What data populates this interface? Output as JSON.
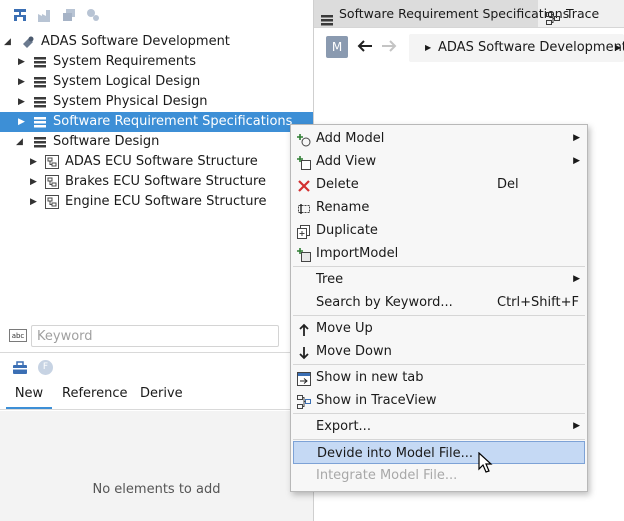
{
  "colors": {
    "selection": "#3d8fd6",
    "menu_highlight": "#c5d9f4",
    "delete_red": "#d32f2f"
  },
  "toolbar_icons": [
    "hierarchy-icon",
    "factory-icon",
    "stack-icon",
    "gear-group-icon"
  ],
  "tree": {
    "root": {
      "label": "ADAS Software Development",
      "icon": "project-icon"
    },
    "items": [
      {
        "label": "System Requirements",
        "icon": "list-icon"
      },
      {
        "label": "System Logical Design",
        "icon": "list-icon"
      },
      {
        "label": "System Physical Design",
        "icon": "list-icon"
      },
      {
        "label": "Software Requirement Specifications",
        "icon": "list-icon",
        "selected": true
      },
      {
        "label": "Software Design",
        "icon": "list-icon",
        "expanded": true
      },
      {
        "label": "ADAS ECU Software Structure",
        "icon": "structure-icon"
      },
      {
        "label": "Brakes ECU Software Structure",
        "icon": "structure-icon"
      },
      {
        "label": "Engine ECU Software Structure",
        "icon": "structure-icon"
      }
    ]
  },
  "keyword": {
    "placeholder": "Keyword",
    "badge": "abc"
  },
  "lower_panel": {
    "tabs": [
      "New",
      "Reference",
      "Derive"
    ],
    "active_tab": "New",
    "empty_text": "No elements to add",
    "filter_badge": "F"
  },
  "editor": {
    "tabs": [
      "Software Requirement Specifications",
      "Trace"
    ],
    "badge": "M",
    "breadcrumb": "ADAS Software Development"
  },
  "context_menu": {
    "items": [
      {
        "label": "Add Model",
        "submenu": true,
        "icon": "add-model-icon"
      },
      {
        "label": "Add View",
        "submenu": true,
        "icon": "add-view-icon"
      },
      {
        "label": "Delete",
        "shortcut": "Del",
        "icon": "delete-icon"
      },
      {
        "label": "Rename",
        "icon": "rename-icon"
      },
      {
        "label": "Duplicate",
        "icon": "duplicate-icon"
      },
      {
        "label": "ImportModel",
        "icon": "import-icon"
      },
      {
        "label": "Tree",
        "submenu": true
      },
      {
        "label": "Search by Keyword...",
        "shortcut": "Ctrl+Shift+F"
      },
      {
        "label": "Move Up",
        "icon": "arrow-up-icon"
      },
      {
        "label": "Move Down",
        "icon": "arrow-down-icon"
      },
      {
        "label": "Show in new tab",
        "icon": "new-tab-icon"
      },
      {
        "label": "Show in TraceView",
        "icon": "traceview-icon"
      },
      {
        "label": "Export...",
        "submenu": true
      },
      {
        "label": "Devide into Model File...",
        "highlighted": true
      },
      {
        "label": "Integrate Model File...",
        "disabled": true
      }
    ]
  }
}
